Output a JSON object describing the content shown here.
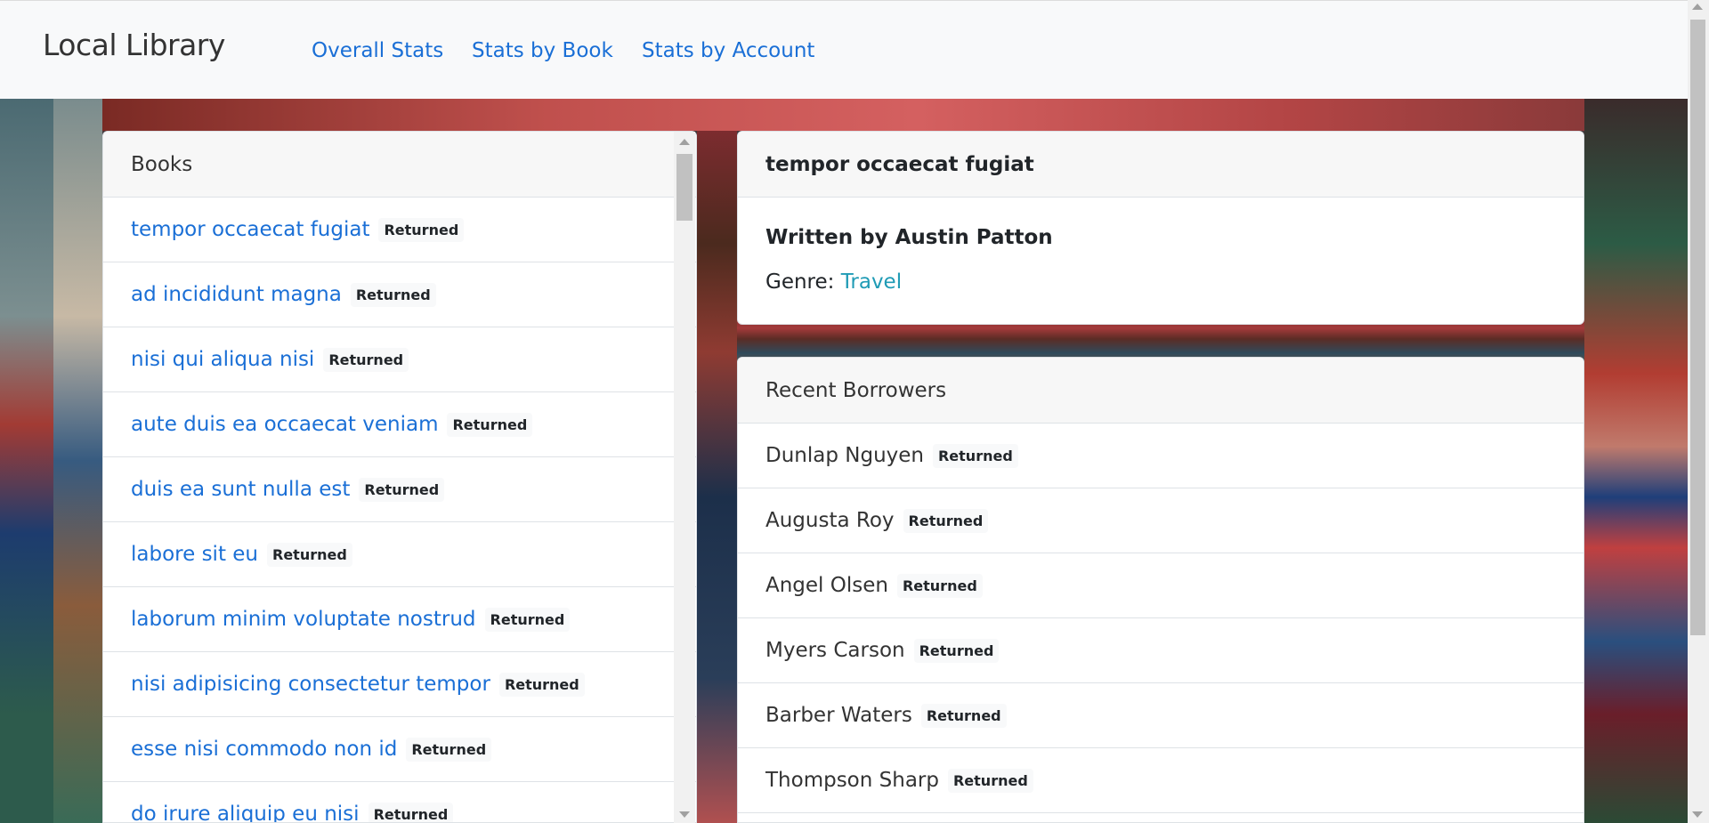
{
  "navbar": {
    "brand": "Local Library",
    "links": [
      "Overall Stats",
      "Stats by Book",
      "Stats by Account"
    ]
  },
  "books": {
    "header": "Books",
    "items": [
      {
        "title": "tempor occaecat fugiat",
        "status": "Returned"
      },
      {
        "title": "ad incididunt magna",
        "status": "Returned"
      },
      {
        "title": "nisi qui aliqua nisi",
        "status": "Returned"
      },
      {
        "title": "aute duis ea occaecat veniam",
        "status": "Returned"
      },
      {
        "title": "duis ea sunt nulla est",
        "status": "Returned"
      },
      {
        "title": "labore sit eu",
        "status": "Returned"
      },
      {
        "title": "laborum minim voluptate nostrud",
        "status": "Returned"
      },
      {
        "title": "nisi adipisicing consectetur tempor",
        "status": "Returned"
      },
      {
        "title": "esse nisi commodo non id",
        "status": "Returned"
      },
      {
        "title": "do irure aliquip eu nisi",
        "status": "Returned"
      }
    ]
  },
  "detail": {
    "title": "tempor occaecat fugiat",
    "author_line": "Written by Austin Patton",
    "genre_label": "Genre:",
    "genre_value": "Travel"
  },
  "borrowers": {
    "header": "Recent Borrowers",
    "items": [
      {
        "name": "Dunlap Nguyen",
        "status": "Returned"
      },
      {
        "name": "Augusta Roy",
        "status": "Returned"
      },
      {
        "name": "Angel Olsen",
        "status": "Returned"
      },
      {
        "name": "Myers Carson",
        "status": "Returned"
      },
      {
        "name": "Barber Waters",
        "status": "Returned"
      },
      {
        "name": "Thompson Sharp",
        "status": "Returned"
      }
    ]
  }
}
